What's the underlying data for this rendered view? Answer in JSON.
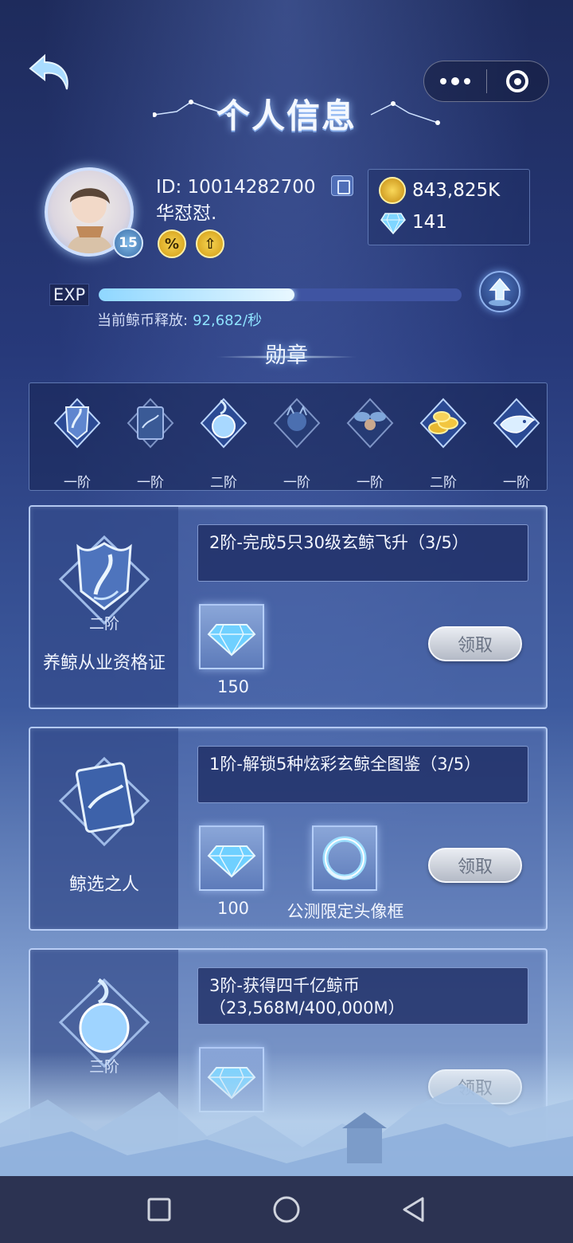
{
  "header": {
    "title": "个人信息"
  },
  "profile": {
    "id_text": "ID: 10014282700",
    "name": "华怼怼.",
    "level": "15",
    "coins": "843,825K",
    "gems": "141",
    "exp_label": "EXP",
    "exp_progress": 0.54,
    "release_label": "当前鲸币释放:",
    "release_value": "92,682/秒"
  },
  "medals": {
    "section_title": "勋章",
    "items": [
      {
        "label": "一阶",
        "icon": "shield-whale-icon"
      },
      {
        "label": "一阶",
        "icon": "book-whale-icon"
      },
      {
        "label": "二阶",
        "icon": "orb-icon"
      },
      {
        "label": "一阶",
        "icon": "creature-icon"
      },
      {
        "label": "一阶",
        "icon": "fairy-icon"
      },
      {
        "label": "二阶",
        "icon": "gold-coins-icon"
      },
      {
        "label": "一阶",
        "icon": "whale-emblem-icon"
      }
    ]
  },
  "achievements": [
    {
      "tier": "二阶",
      "name": "养鲸从业资格证",
      "task": "2阶-完成5只30级玄鲸飞升（3/5）",
      "rewards": [
        {
          "label": "150",
          "icon": "diamond-icon"
        }
      ],
      "claim": "领取"
    },
    {
      "tier": "",
      "name": "鲸选之人",
      "task": "1阶-解锁5种炫彩玄鲸全图鉴（3/5）",
      "rewards": [
        {
          "label": "100",
          "icon": "diamond-icon"
        },
        {
          "label": "公测限定头像框",
          "icon": "avatar-frame-icon"
        }
      ],
      "claim": "领取"
    },
    {
      "tier": "三阶",
      "name": "",
      "task": "3阶-获得四千亿鲸币（23,568M/400,000M）",
      "rewards": [
        {
          "label": "",
          "icon": "diamond-icon"
        }
      ],
      "claim": "领取"
    }
  ],
  "colors": {
    "accent": "#8ee3ff",
    "card_border": "#c8dcff",
    "bg_top": "#1e2b5c"
  }
}
